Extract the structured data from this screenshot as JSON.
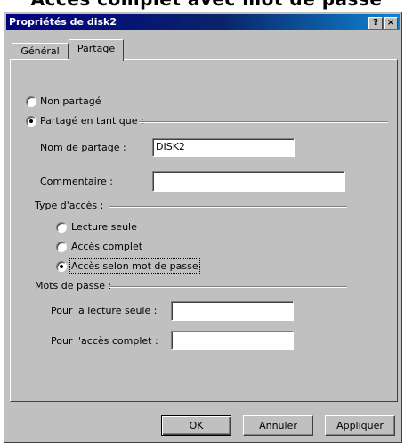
{
  "caption": "Accès complet avec mot de passe",
  "window": {
    "title": "Propriétés de disk2",
    "help_btn": "?",
    "close_btn": "×"
  },
  "tabs": [
    {
      "label": "Général"
    },
    {
      "label": "Partage"
    }
  ],
  "sharing": {
    "not_shared_label": "Non partagé",
    "shared_as_label": "Partagé en tant que :",
    "share_name_label": "Nom de partage :",
    "share_name_value": "DISK2",
    "comment_label": "Commentaire :",
    "comment_value": ""
  },
  "access_type": {
    "group_label": "Type d'accès :",
    "read_only_label": "Lecture seule",
    "full_label": "Accès complet",
    "password_label": "Accès selon mot de passe"
  },
  "passwords": {
    "group_label": "Mots de passe :",
    "read_only_label": "Pour la lecture seule :",
    "read_only_value": "",
    "full_label": "Pour l'accès complet :",
    "full_value": ""
  },
  "buttons": {
    "ok": "OK",
    "cancel": "Annuler",
    "apply": "Appliquer"
  }
}
